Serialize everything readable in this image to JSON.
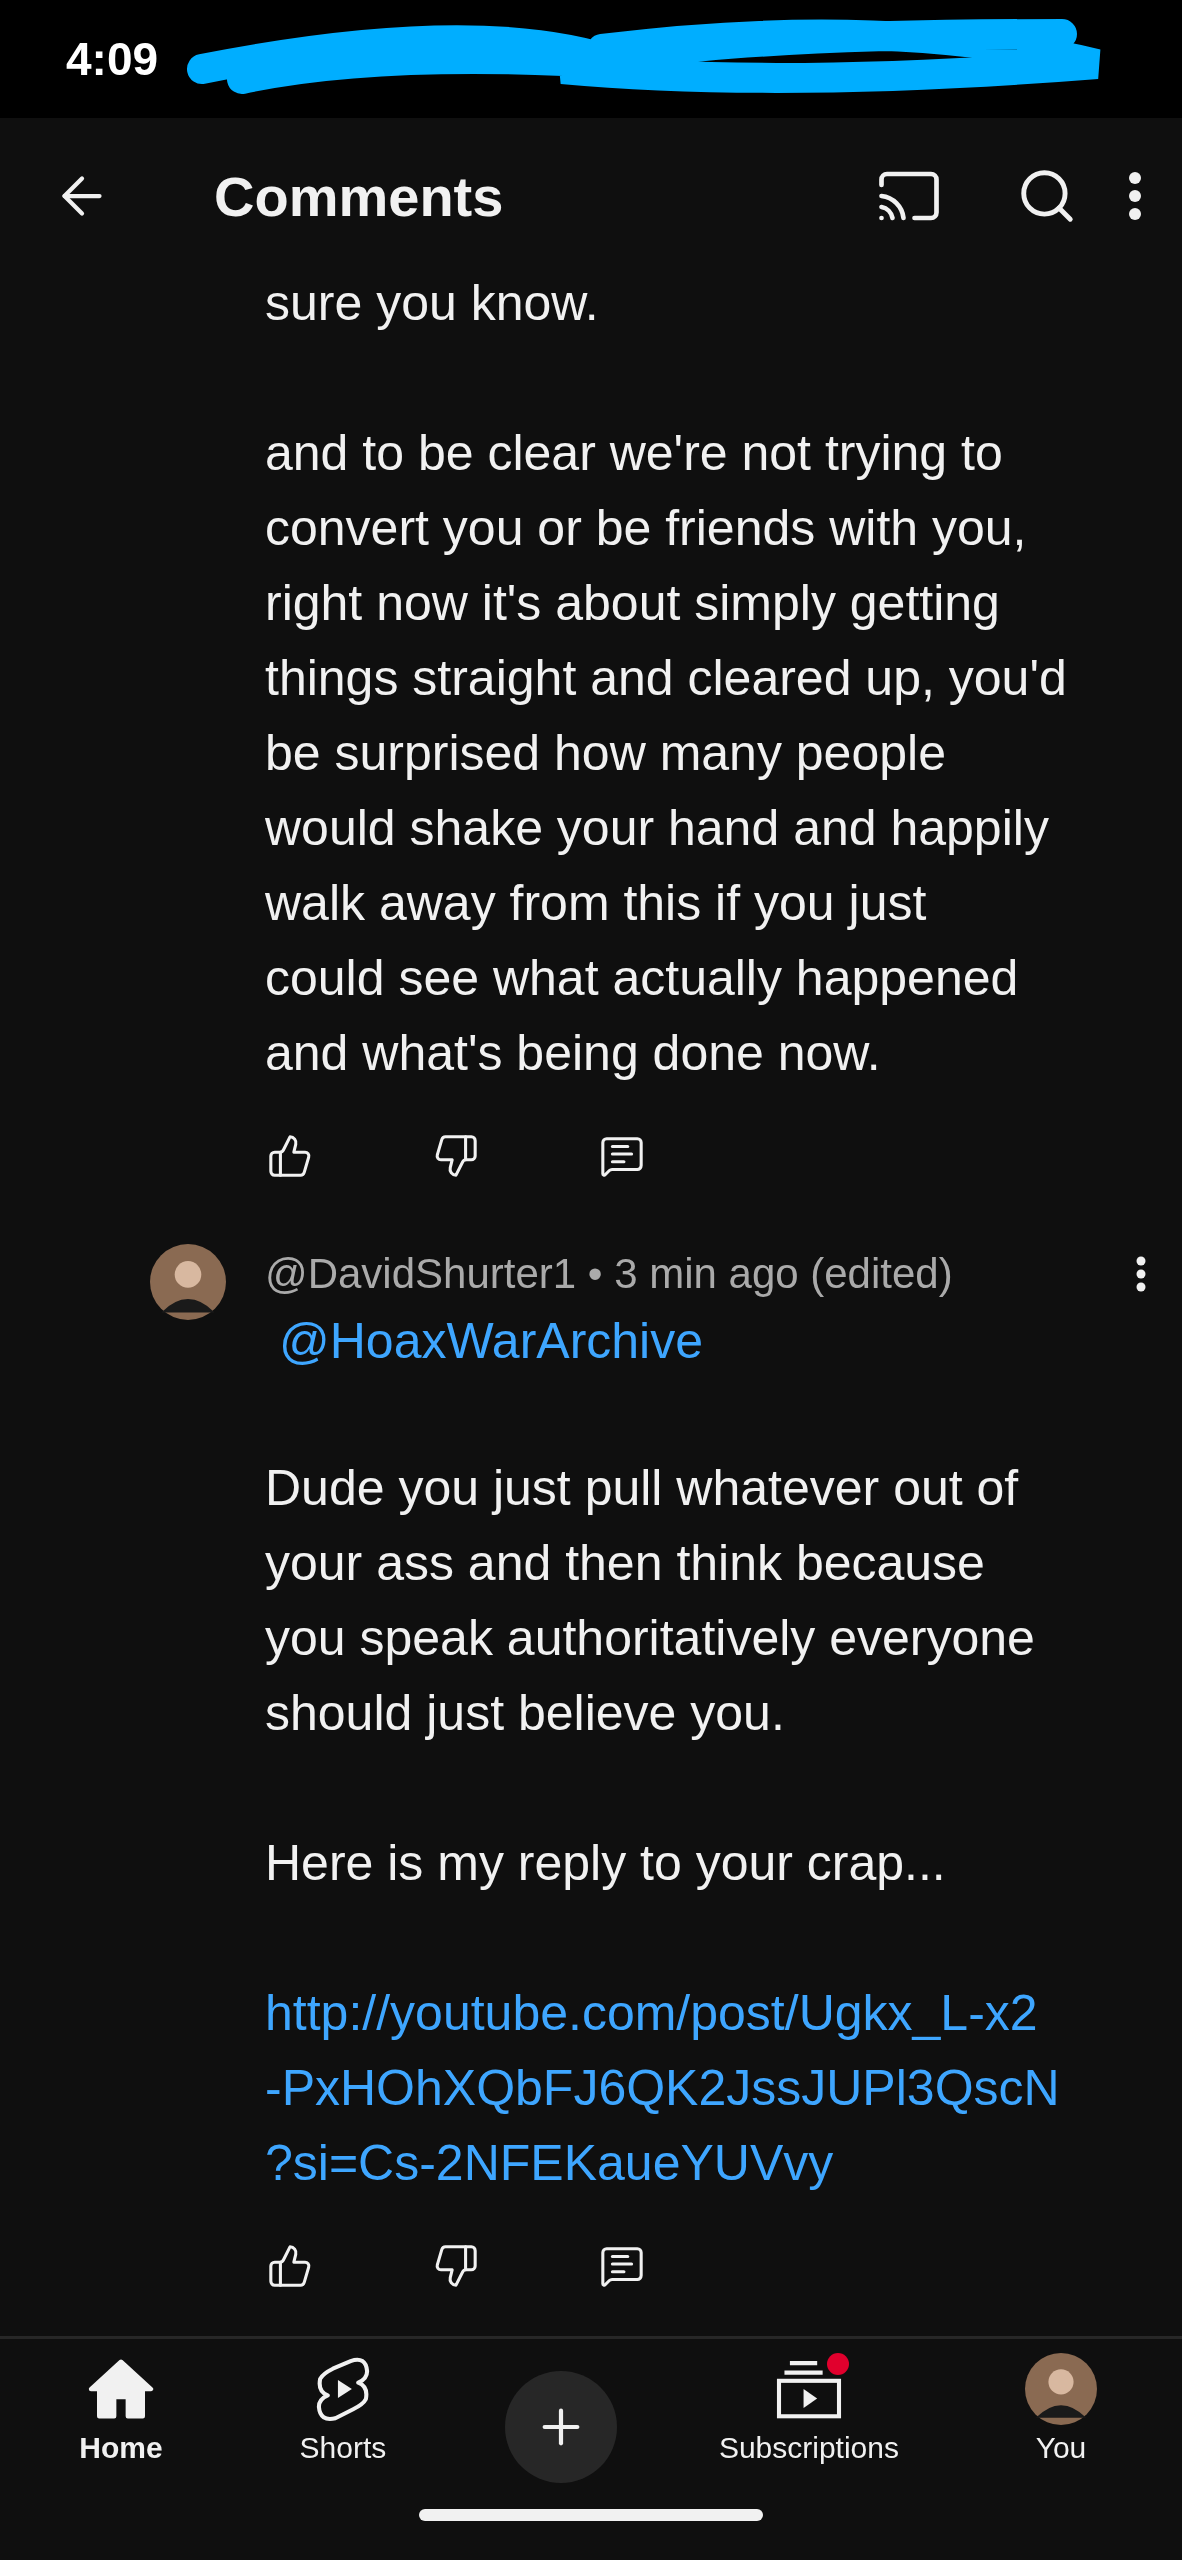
{
  "status_bar": {
    "time": "4:09"
  },
  "header": {
    "title": "Comments"
  },
  "comments": [
    {
      "blocks": [
        {
          "kind": "text",
          "lines": [
            "sure you know."
          ]
        },
        {
          "kind": "text",
          "lines": [
            "and to be clear we're not trying to",
            "convert you or be friends with you,",
            "right now it's about simply getting",
            "things straight and cleared up, you'd",
            "be surprised how many people",
            "would shake your hand and happily",
            "walk away from this if you just",
            "could see what actually happened",
            "and what's being done now."
          ]
        }
      ]
    },
    {
      "meta": "@DavidShurter1 • 3 min ago (edited)",
      "mention": "@HoaxWarArchive",
      "blocks": [
        {
          "kind": "text",
          "lines": [
            "Dude you just pull whatever out of",
            "your ass and then think because",
            "you speak authoritatively everyone",
            "should just believe you."
          ]
        },
        {
          "kind": "text",
          "lines": [
            "Here is my reply to your crap..."
          ]
        },
        {
          "kind": "link",
          "lines": [
            "http://youtube.com/post/Ugkx_L-x2",
            "-PxHOhXQbFJ6QK2JssJUPl3QscN",
            "?si=Cs-2NFEKaueYUVvy"
          ]
        }
      ]
    }
  ],
  "nav": [
    {
      "kind": "home",
      "label": "Home",
      "selected": true
    },
    {
      "kind": "shorts",
      "label": "Shorts",
      "selected": false
    },
    {
      "kind": "create"
    },
    {
      "kind": "subscriptions",
      "label": "Subscriptions",
      "selected": false,
      "badge": true
    },
    {
      "kind": "you",
      "label": "You",
      "selected": false
    }
  ]
}
